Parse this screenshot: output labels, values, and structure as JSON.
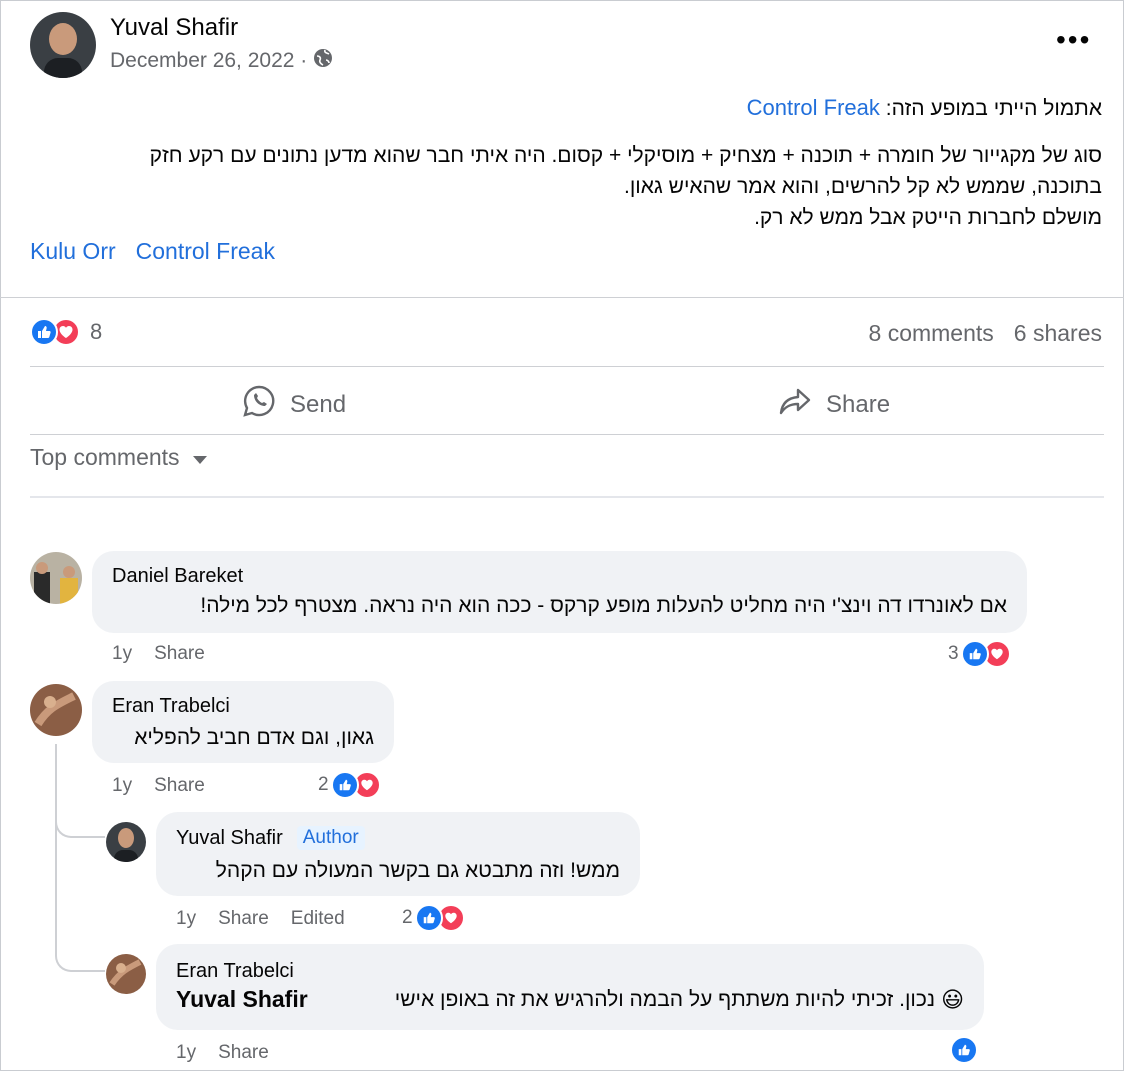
{
  "post": {
    "author": "Yuval Shafir",
    "date": "December 26, 2022 ·",
    "line1_prefix": "אתמול הייתי במופע הזה:",
    "line1_link": "Control Freak",
    "body_lines": [
      "סוג של מקגייור של חומרה + תוכנה + מצחיק + מוסיקלי + קסום. היה איתי חבר שהוא מדען נתונים עם רקע חזק",
      "בתוכנה, שממש לא קל להרשים, והוא אמר שהאיש גאון.",
      "מושלם לחברות הייטק אבל ממש לא רק."
    ],
    "tags": [
      "Kulu Orr",
      "Control Freak"
    ]
  },
  "stats": {
    "reactions_count": "8",
    "comments": "8 comments",
    "shares": "6 shares"
  },
  "actions": {
    "send": "Send",
    "share": "Share"
  },
  "sort": {
    "label": "Top comments"
  },
  "comments": [
    {
      "name": "Daniel Bareket",
      "text": "אם לאונרדו דה וינצ'י היה מחליט להעלות מופע קרקס - ככה הוא היה נראה. מצטרף לכל מילה!",
      "time": "1y",
      "share": "Share",
      "reactions": "3"
    },
    {
      "name": "Eran Trabelci",
      "text": "גאון, וגם אדם חביב להפליא",
      "time": "1y",
      "share": "Share",
      "reactions": "2"
    }
  ],
  "replies": [
    {
      "name": "Yuval Shafir",
      "badge": "Author",
      "text": "ממש! וזה מתבטא גם בקשר המעולה עם הקהל",
      "time": "1y",
      "share": "Share",
      "edited": "Edited",
      "reactions": "2"
    },
    {
      "name": "Eran Trabelci",
      "mention": "Yuval Shafir",
      "text": "נכון. זכיתי להיות משתתף על הבמה ולהרגיש את זה באופן אישי",
      "emoji": "😃",
      "time": "1y",
      "share": "Share"
    }
  ],
  "colors": {
    "link": "#216fdb",
    "like": "#1877f2",
    "love": "#f33e58",
    "bubble": "#f0f2f5"
  }
}
